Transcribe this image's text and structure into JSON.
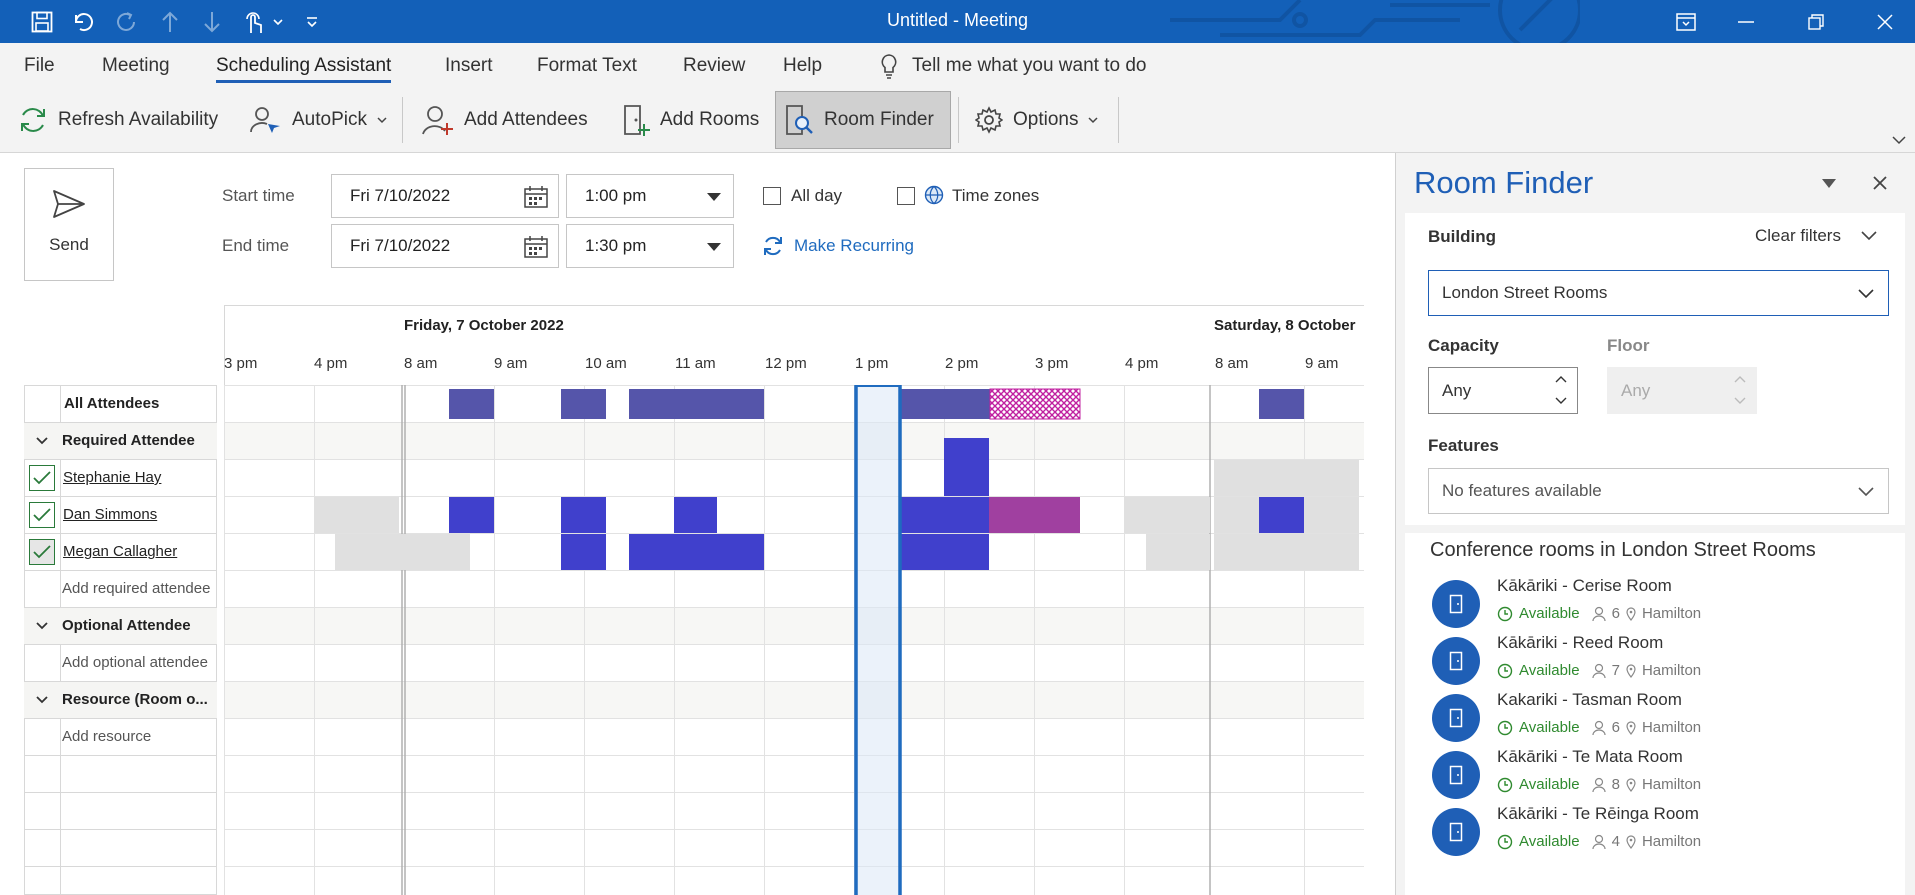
{
  "window": {
    "title": "Untitled  -  Meeting"
  },
  "ribbon_tabs": [
    "File",
    "Meeting",
    "Scheduling Assistant",
    "Insert",
    "Format Text",
    "Review",
    "Help"
  ],
  "tell_me": "Tell me what you want to do",
  "toolbar": {
    "refresh": "Refresh Availability",
    "autopick": "AutoPick",
    "add_attendees": "Add Attendees",
    "add_rooms": "Add Rooms",
    "room_finder": "Room Finder",
    "options": "Options"
  },
  "send_label": "Send",
  "times": {
    "start_label": "Start time",
    "end_label": "End time",
    "start_date": "Fri 7/10/2022",
    "start_time": "1:00 pm",
    "end_date": "Fri 7/10/2022",
    "end_time": "1:30 pm",
    "all_day": "All day",
    "time_zones": "Time zones",
    "make_recurring": "Make Recurring"
  },
  "schedule": {
    "date_1": "Friday, 7 October 2022",
    "date_2": "Saturday, 8 October",
    "hours": [
      "3 pm",
      "4 pm",
      "8 am",
      "9 am",
      "10 am",
      "11 am",
      "12 pm",
      "1 pm",
      "2 pm",
      "3 pm",
      "4 pm",
      "8 am",
      "9 am"
    ]
  },
  "attendees": {
    "all": "All Attendees",
    "required_group": "Required Attendee",
    "required": [
      "Stephanie Hay",
      "Dan Simmons",
      "Megan Callagher"
    ],
    "add_required": "Add required attendee",
    "optional_group": "Optional Attendee",
    "add_optional": "Add optional attendee",
    "resource_group": "Resource (Room o...",
    "add_resource": "Add resource"
  },
  "room_finder": {
    "title": "Room Finder",
    "building_label": "Building",
    "clear_filters": "Clear filters",
    "building_value": "London Street Rooms",
    "capacity_label": "Capacity",
    "capacity_value": "Any",
    "floor_label": "Floor",
    "floor_value": "Any",
    "features_label": "Features",
    "features_value": "No features available",
    "list_heading": "Conference rooms in London Street Rooms",
    "rooms": [
      {
        "name": "Kākāriki - Cerise Room",
        "status": "Available",
        "capacity": "6",
        "location": "Hamilton"
      },
      {
        "name": "Kākāriki - Reed Room",
        "status": "Available",
        "capacity": "7",
        "location": "Hamilton"
      },
      {
        "name": "Kakariki - Tasman Room",
        "status": "Available",
        "capacity": "6",
        "location": "Hamilton"
      },
      {
        "name": "Kākāriki - Te Mata Room",
        "status": "Available",
        "capacity": "8",
        "location": "Hamilton"
      },
      {
        "name": "Kākāriki - Te Rēinga Room",
        "status": "Available",
        "capacity": "4",
        "location": "Hamilton"
      }
    ]
  },
  "colors": {
    "accent": "#1f5fb6",
    "titlebar": "#1360b8",
    "busy": "#4040cc",
    "busy_summary": "#5555aa",
    "tentative": "#a040a0",
    "available": "#2f8a2f"
  }
}
